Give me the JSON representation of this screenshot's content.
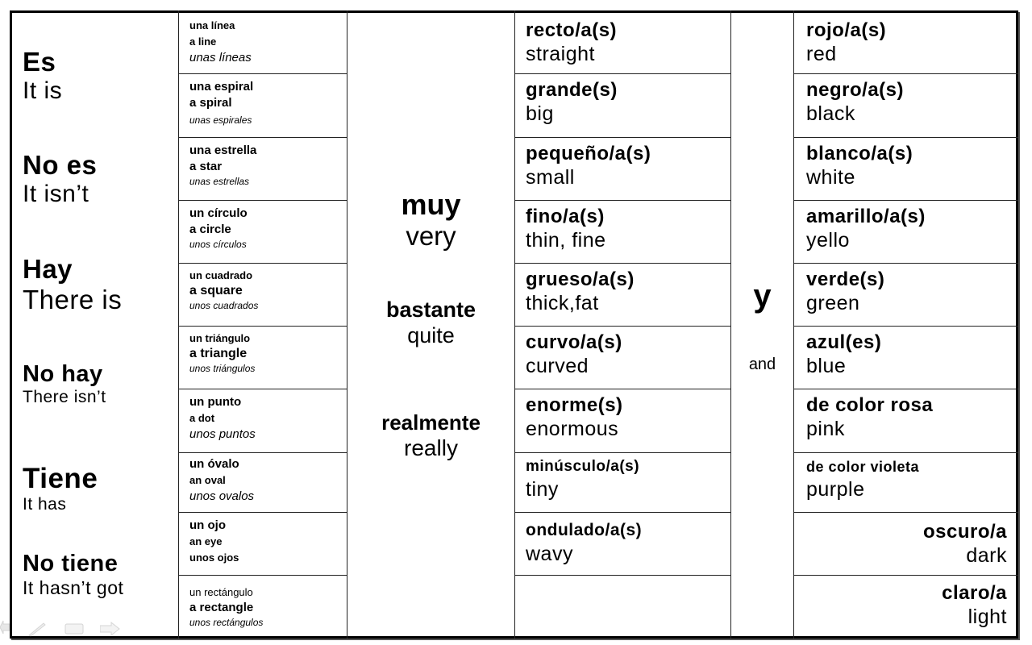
{
  "verbs": [
    {
      "es": "Es",
      "en": "It is"
    },
    {
      "es": "No es",
      "en": "It isn’t"
    },
    {
      "es": "Hay",
      "en": "There is"
    },
    {
      "es": "No hay",
      "en": "There isn’t"
    },
    {
      "es": "Tiene",
      "en": "It has"
    },
    {
      "es": "No tiene",
      "en": "It hasn’t got"
    }
  ],
  "shapes": [
    {
      "singular": "una línea",
      "english": "a line",
      "plural": "unas líneas"
    },
    {
      "singular": "una espiral",
      "english": "a spiral",
      "plural": "unas espirales"
    },
    {
      "singular": "una estrella",
      "english": "a star",
      "plural": "unas estrellas"
    },
    {
      "singular": "un círculo",
      "english": "a circle",
      "plural": "unos círculos"
    },
    {
      "singular": "un cuadrado",
      "english": "a square",
      "plural": "unos cuadrados"
    },
    {
      "singular": "un triángulo",
      "english": "a triangle",
      "plural": "unos triángulos"
    },
    {
      "singular": "un punto",
      "english": "a dot",
      "plural": "unos puntos"
    },
    {
      "singular": "un óvalo",
      "english": "an oval",
      "plural": "unos ovalos"
    },
    {
      "singular": "un ojo",
      "english": "an eye",
      "plural": "unos ojos"
    },
    {
      "singular": "un rectángulo",
      "english": "a rectangle",
      "plural": "unos rectángulos"
    }
  ],
  "modifiers": [
    {
      "es": "muy",
      "en": "very"
    },
    {
      "es": "bastante",
      "en": "quite"
    },
    {
      "es": "realmente",
      "en": "really"
    }
  ],
  "adjectives": [
    {
      "es": "recto/a(s)",
      "en": "straight"
    },
    {
      "es": "grande(s)",
      "en": "big"
    },
    {
      "es": "pequeño/a(s)",
      "en": "small"
    },
    {
      "es": "fino/a(s)",
      "en": "thin, fine"
    },
    {
      "es": "grueso/a(s)",
      "en": "thick,fat"
    },
    {
      "es": "curvo/a(s)",
      "en": "curved"
    },
    {
      "es": "enorme(s)",
      "en": "enormous"
    },
    {
      "es": "minúsculo/a(s)",
      "en": "tiny"
    },
    {
      "es": "ondulado/a(s)",
      "en": "wavy"
    }
  ],
  "conjunction": {
    "es": "y",
    "en": "and"
  },
  "colours": [
    {
      "es": "rojo/a(s)",
      "en": "red"
    },
    {
      "es": "negro/a(s)",
      "en": "black"
    },
    {
      "es": "blanco/a(s)",
      "en": "white"
    },
    {
      "es": "amarillo/a(s)",
      "en": "yello"
    },
    {
      "es": "verde(s)",
      "en": "green"
    },
    {
      "es": "azul(es)",
      "en": "blue"
    },
    {
      "es": "de color rosa",
      "en": "pink"
    },
    {
      "es": "de color violeta",
      "en": "purple"
    },
    {
      "es": "oscuro/a",
      "en": "dark"
    },
    {
      "es": "claro/a",
      "en": "light"
    }
  ],
  "slideshow_controls": [
    "previous-slide-icon",
    "pen-icon",
    "slide-menu-icon",
    "next-slide-icon"
  ]
}
